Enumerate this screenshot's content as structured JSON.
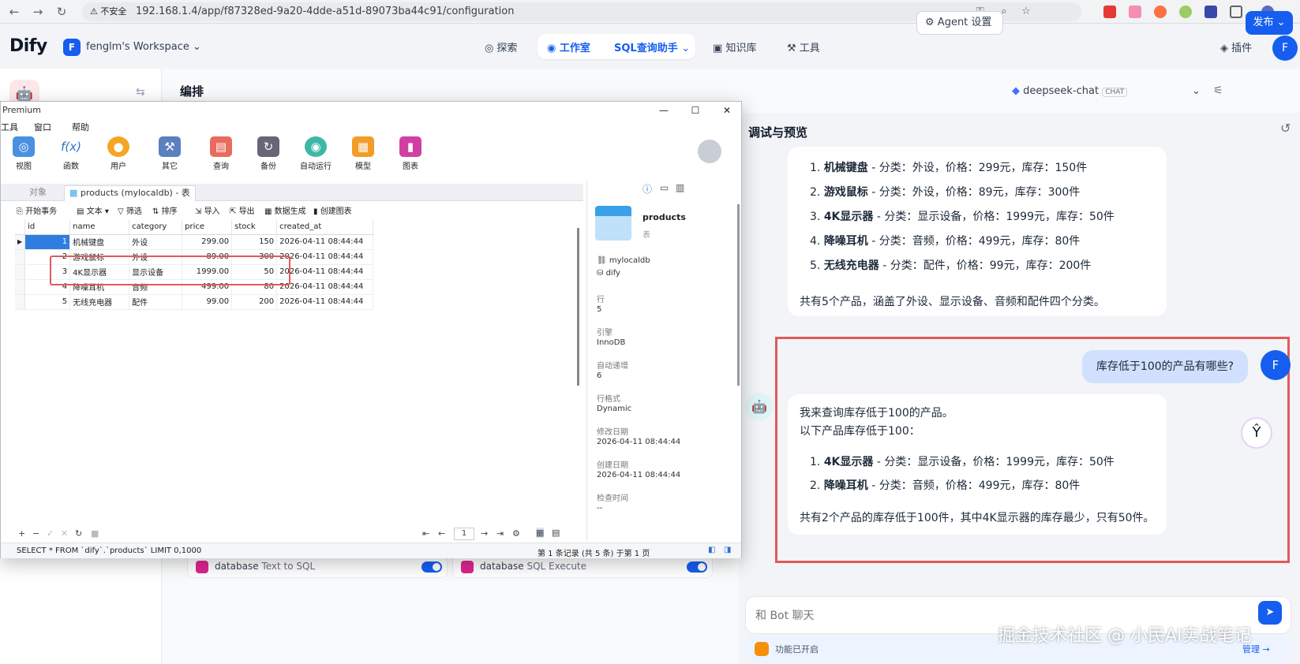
{
  "browser": {
    "security_badge": "不安全",
    "url": "192.168.1.4/app/f87328ed-9a20-4dde-a51d-89073ba44c91/configuration"
  },
  "header": {
    "logo": "Dify",
    "workspace_initial": "F",
    "workspace_name": "fenglm's Workspace",
    "nav_explore": "探索",
    "nav_studio": "工作室",
    "current_app": "SQL查询助手",
    "nav_knowledge": "知识库",
    "nav_tools": "工具",
    "plugins": "插件",
    "user_initial": "F"
  },
  "editor": {
    "title": "编排",
    "agent_settings": "Agent 设置",
    "model_name": "deepseek-chat",
    "model_tag": "CHAT",
    "publish": "发布"
  },
  "tools_strip": {
    "tool1_provider": "database",
    "tool1_name": "Text to SQL",
    "tool2_provider": "database",
    "tool2_name": "SQL Execute"
  },
  "debug": {
    "title": "调试与预览",
    "prev_answer": {
      "items": [
        {
          "name": "机械键盘",
          "rest": " - 分类：外设，价格：299元，库存：150件"
        },
        {
          "name": "游戏鼠标",
          "rest": " - 分类：外设，价格：89元，库存：300件"
        },
        {
          "name": "4K显示器",
          "rest": " - 分类：显示设备，价格：1999元，库存：50件"
        },
        {
          "name": "降噪耳机",
          "rest": " - 分类：音频，价格：499元，库存：80件"
        },
        {
          "name": "无线充电器",
          "rest": " - 分类：配件，价格：99元，库存：200件"
        }
      ],
      "summary": "共有5个产品，涵盖了外设、显示设备、音频和配件四个分类。"
    },
    "user_question": "库存低于100的产品有哪些?",
    "user_initial": "F",
    "answer": {
      "line1": "我来查询库存低于100的产品。",
      "line2": "以下产品库存低于100：",
      "items": [
        {
          "name": "4K显示器",
          "rest": " - 分类：显示设备，价格：1999元，库存：50件"
        },
        {
          "name": "降噪耳机",
          "rest": " - 分类：音频，价格：499元，库存：80件"
        }
      ],
      "summary": "共有2个产品的库存低于100件，其中4K显示器的库存最少，只有50件。"
    },
    "input_placeholder": "和 Bot 聊天",
    "feature_text": "功能已开启",
    "manage": "管理",
    "watermark": "掘金技术社区 @ 小民AI实战笔记"
  },
  "navicat": {
    "title": "Premium",
    "menu": [
      "工具",
      "窗口",
      "帮助"
    ],
    "toolbar": [
      "视图",
      "函数",
      "用户",
      "其它",
      "查询",
      "备份",
      "自动运行",
      "模型",
      "图表"
    ],
    "tab_objects": "对象",
    "tab_table": "products (mylocaldb) - 表",
    "subtools": [
      "开始事务",
      "文本",
      "筛选",
      "排序",
      "导入",
      "导出",
      "数据生成",
      "创建图表"
    ],
    "columns": [
      "id",
      "name",
      "category",
      "price",
      "stock",
      "created_at"
    ],
    "rows": [
      [
        "1",
        "机械键盘",
        "外设",
        "299.00",
        "150",
        "2026-04-11 08:44:44"
      ],
      [
        "2",
        "游戏鼠标",
        "外设",
        "89.00",
        "300",
        "2026-04-11 08:44:44"
      ],
      [
        "3",
        "4K显示器",
        "显示设备",
        "1999.00",
        "50",
        "2026-04-11 08:44:44"
      ],
      [
        "4",
        "降噪耳机",
        "音频",
        "499.00",
        "80",
        "2026-04-11 08:44:44"
      ],
      [
        "5",
        "无线充电器",
        "配件",
        "99.00",
        "200",
        "2026-04-11 08:44:44"
      ]
    ],
    "page_num": "1",
    "sql": "SELECT * FROM `dify`.`products` LIMIT 0,1000",
    "record_info": "第 1 条记录 (共 5 条) 于第 1 页",
    "info": {
      "table_name": "products",
      "table_kind": "表",
      "connection": "mylocaldb",
      "database": "dify",
      "rows_label": "行",
      "rows_value": "5",
      "engine_label": "引擎",
      "engine_value": "InnoDB",
      "autoinc_label": "自动递增",
      "autoinc_value": "6",
      "rowformat_label": "行格式",
      "rowformat_value": "Dynamic",
      "modified_label": "修改日期",
      "modified_value": "2026-04-11 08:44:44",
      "created_label": "创建日期",
      "created_value": "2026-04-11 08:44:44",
      "checked_label": "检查时间",
      "checked_value": "--"
    }
  }
}
